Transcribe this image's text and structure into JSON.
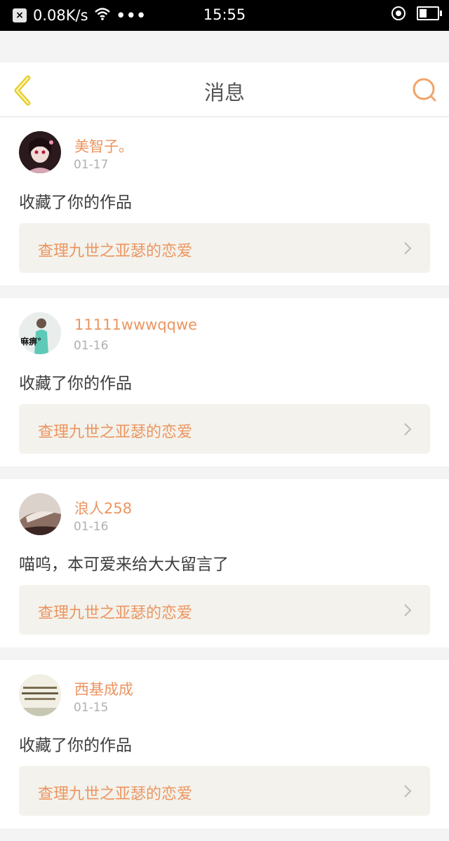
{
  "status_bar": {
    "net_speed": "0.08K/s",
    "dots": "•••",
    "time": "15:55",
    "battery_level": 0.4,
    "icons": [
      "close-notification-icon",
      "wifi-icon",
      "location-icon",
      "battery-icon"
    ]
  },
  "header": {
    "title": "消息",
    "back_icon": "chevron-left-icon",
    "search_icon": "search-icon",
    "accent_color": "#f0a46a"
  },
  "messages": [
    {
      "user": "美智子。",
      "date": "01-17",
      "text": "收藏了你的作品",
      "work": "查理九世之亚瑟的恋爱",
      "avatar": "avatar-doll",
      "avatar_label": ""
    },
    {
      "user": "11111wwwqqwe",
      "date": "01-16",
      "text": "收藏了你的作品",
      "work": "查理九世之亚瑟的恋爱",
      "avatar": "avatar-girl",
      "avatar_label": "麻痹°"
    },
    {
      "user": "浪人258",
      "date": "01-16",
      "text": "喵呜，本可爱来给大大留言了",
      "work": "查理九世之亚瑟的恋爱",
      "avatar": "avatar-hand",
      "avatar_label": ""
    },
    {
      "user": "西基成成",
      "date": "01-15",
      "text": "收藏了你的作品",
      "work": "查理九世之亚瑟的恋爱",
      "avatar": "avatar-text",
      "avatar_label": ""
    }
  ],
  "colors": {
    "username": "#ec9560",
    "work_link_bg": "#f3f2ec"
  }
}
